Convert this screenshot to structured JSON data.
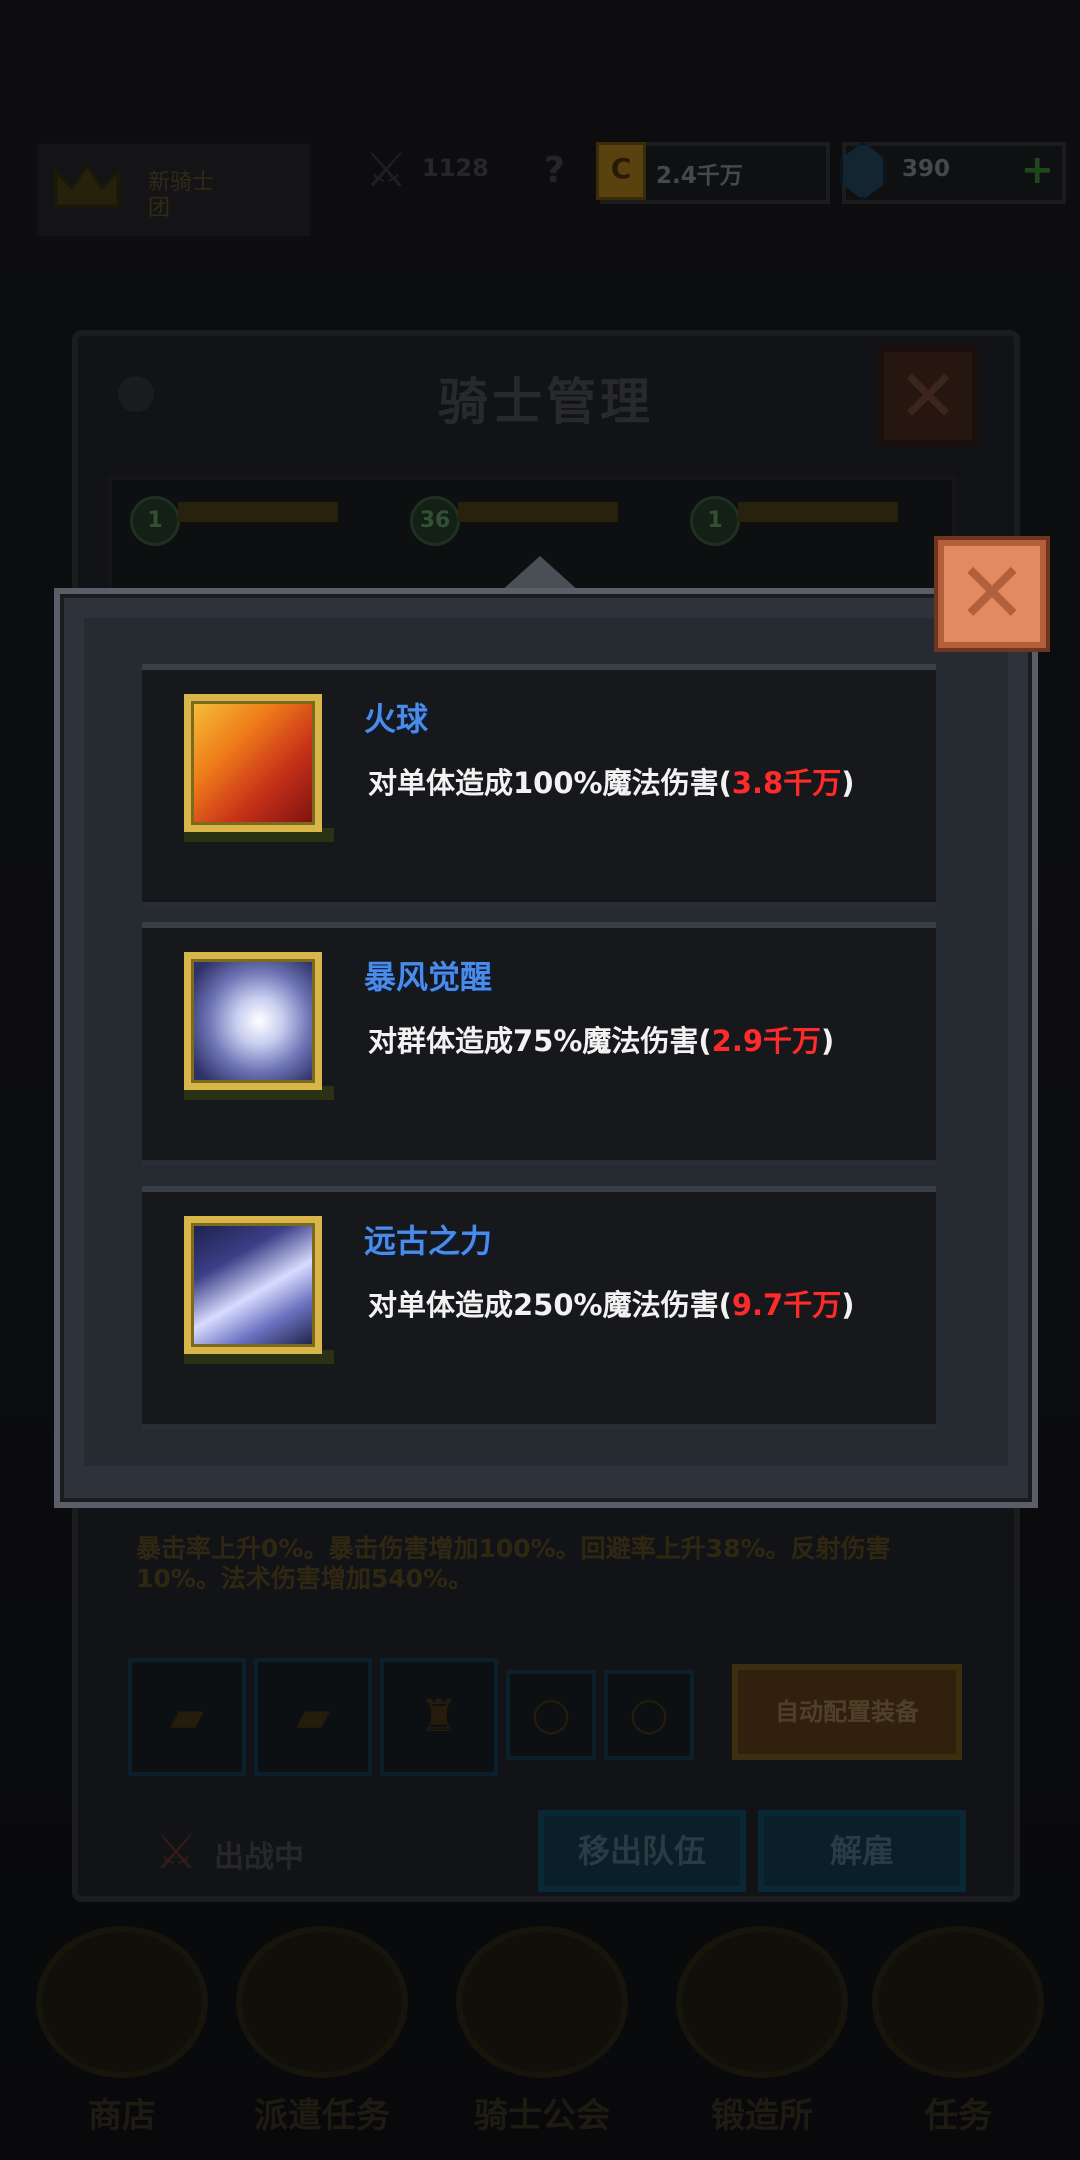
{
  "topbar": {
    "player_label": "新骑士\n团",
    "power_value": "1128",
    "power_help": "?",
    "gold_value": "2.4千万",
    "gold_icon_glyph": "C",
    "gem_value": "390",
    "gem_plus": "+"
  },
  "knight_management": {
    "title": "骑士管理",
    "close_glyph": "✕",
    "roster_levels": [
      "1",
      "36",
      "1"
    ],
    "description": "暴击率上升0%。暴击伤害增加100%。回避率上升38%。反射伤害10%。法术伤害增加540%。",
    "auto_equip_label": "自动配置装备",
    "deployed_label": "出战中",
    "remove_team_label": "移出队伍",
    "dismiss_label": "解雇"
  },
  "bottom_nav": {
    "items": [
      {
        "label": "商店"
      },
      {
        "label": "派遣任务"
      },
      {
        "label": "骑士公会"
      },
      {
        "label": "锻造所"
      },
      {
        "label": "任务"
      }
    ]
  },
  "skills_popup": {
    "close_glyph": "✕",
    "skills": [
      {
        "name": "火球",
        "desc_prefix": "对单体造成100%魔法伤害(",
        "damage": "3.8千万",
        "desc_suffix": ")",
        "icon": "fireball-icon"
      },
      {
        "name": "暴风觉醒",
        "desc_prefix": "对群体造成75%魔法伤害(",
        "damage": "2.9千万",
        "desc_suffix": ")",
        "icon": "storm-icon"
      },
      {
        "name": "远古之力",
        "desc_prefix": "对单体造成250%魔法伤害(",
        "damage": "9.7千万",
        "desc_suffix": ")",
        "icon": "ancient-power-icon"
      }
    ]
  },
  "colors": {
    "skill_name": "#4a8be8",
    "damage_value": "#ff2a2a",
    "icon_frame": "#d9b64a",
    "close_button": "#e38a63"
  }
}
